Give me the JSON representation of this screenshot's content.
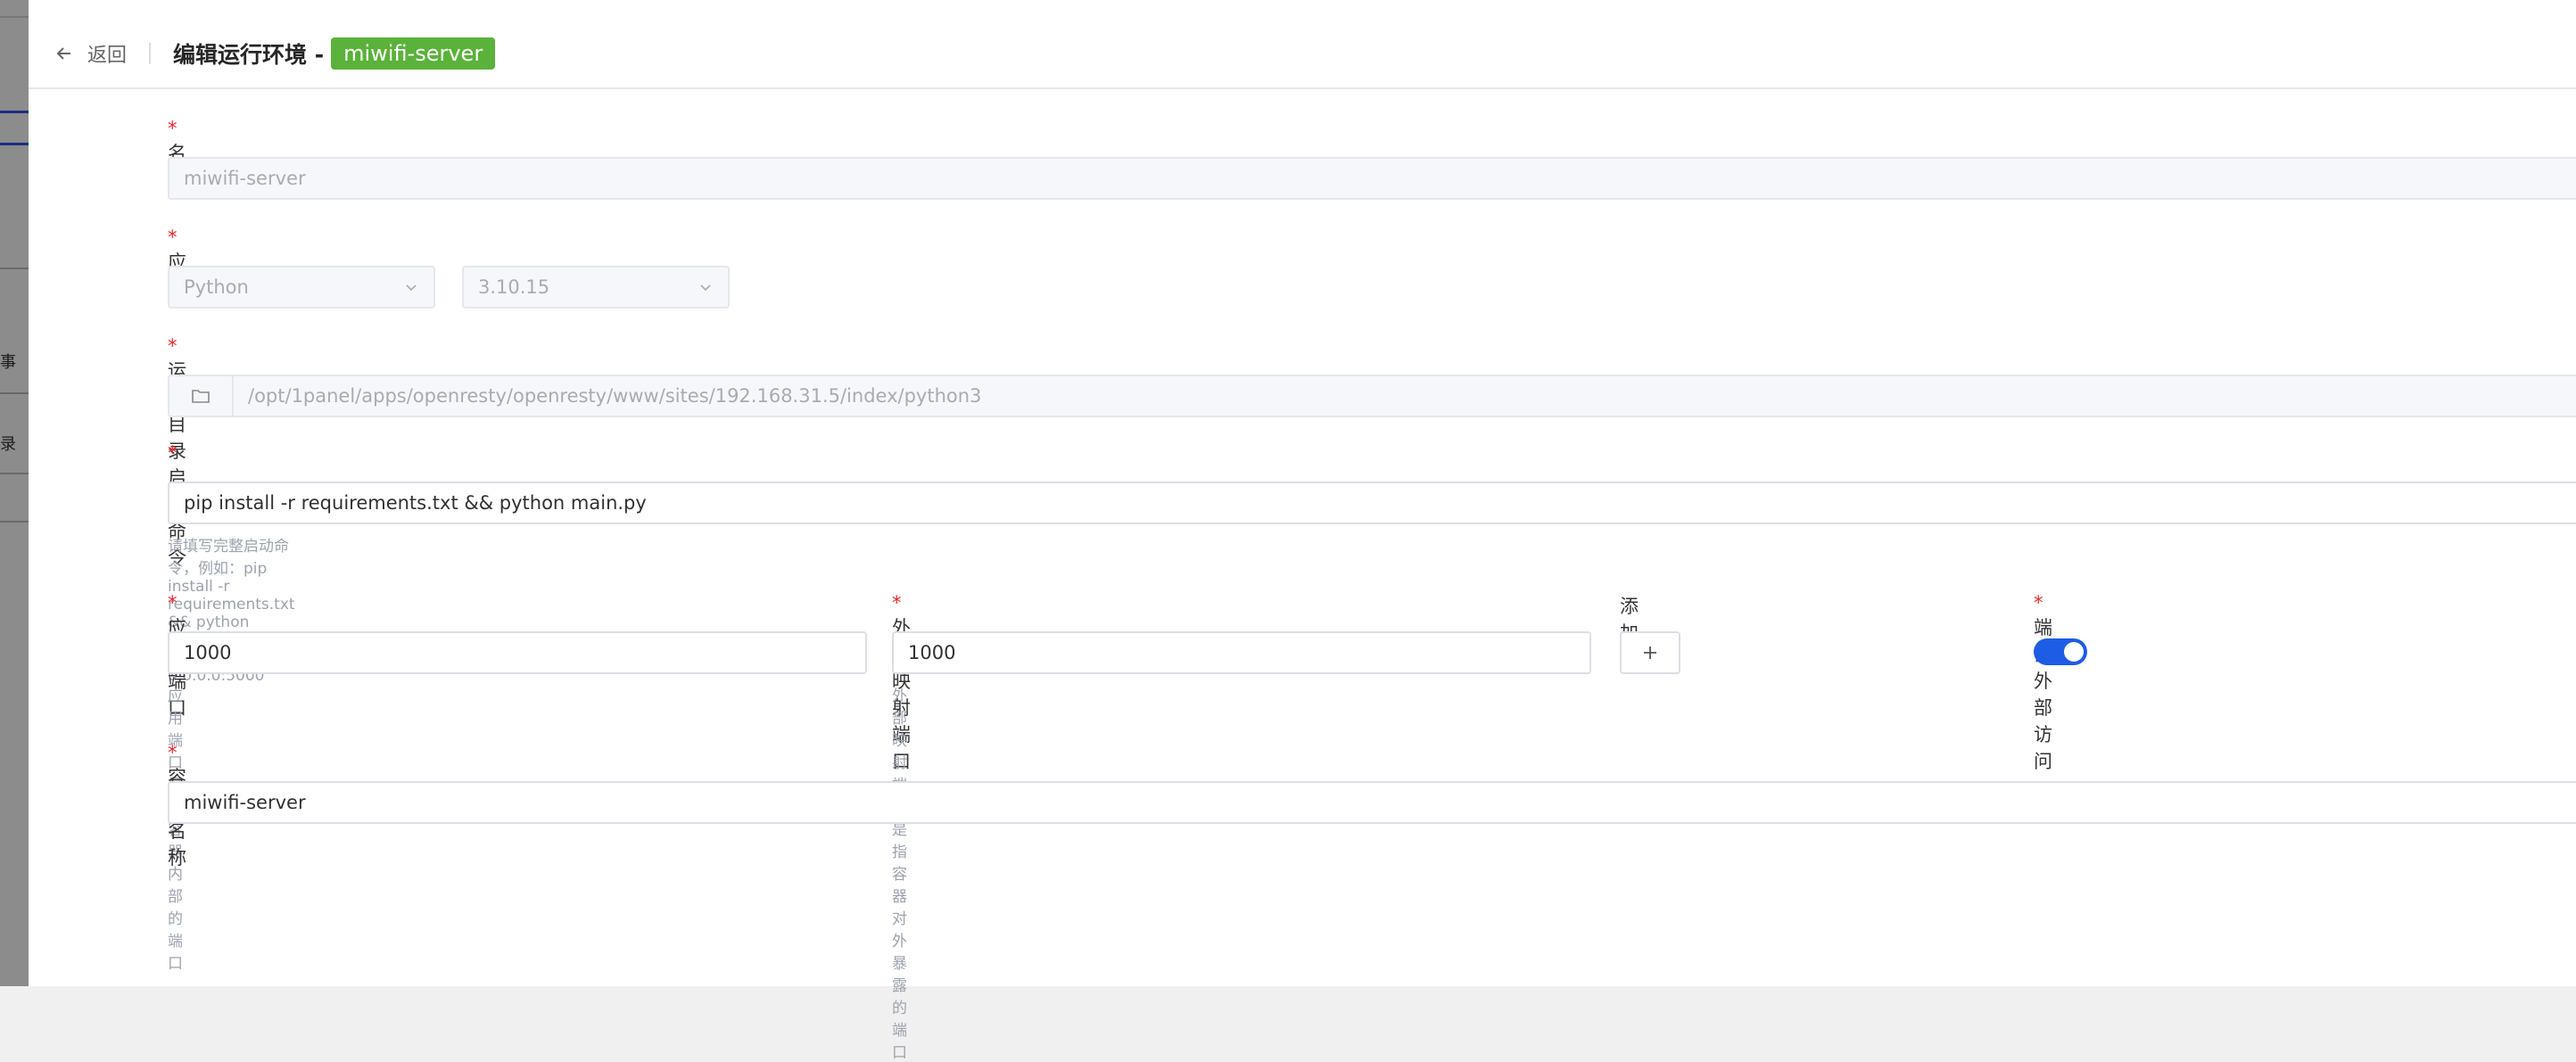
{
  "background": {
    "fragments": [
      "事",
      "录"
    ]
  },
  "header": {
    "back_label": "返回",
    "title_prefix": "编辑运行环境 -",
    "name_tag": "miwifi-server"
  },
  "form": {
    "name": {
      "label": "名称",
      "value": "miwifi-server"
    },
    "app": {
      "label": "应用",
      "type_value": "Python",
      "version_value": "3.10.15"
    },
    "run_dir": {
      "label": "运行目录",
      "value": "/opt/1panel/apps/openresty/openresty/www/sites/192.168.31.5/index/python3"
    },
    "start_cmd": {
      "label": "启动命令",
      "value": "pip install -r requirements.txt && python main.py",
      "hint": "请填写完整启动命令，例如：pip install -r requirements.txt && python manage.py runserver 0.0.0.0:5000"
    },
    "app_port": {
      "label": "应用端口",
      "value": "1000",
      "hint": "应用端口是指容器内部的端口"
    },
    "ext_port": {
      "label": "外部映射端口",
      "value": "1000",
      "hint": "外部映射端口是指容器对外暴露的端口"
    },
    "add": {
      "label": "添加"
    },
    "port_access": {
      "label": "端口外部访问",
      "enabled": true
    },
    "container_name": {
      "label": "容器名称",
      "value": "miwifi-server"
    }
  },
  "colors": {
    "accent": "#1d5ce5",
    "tag_green": "#5ab23a",
    "required": "#f5222d"
  }
}
